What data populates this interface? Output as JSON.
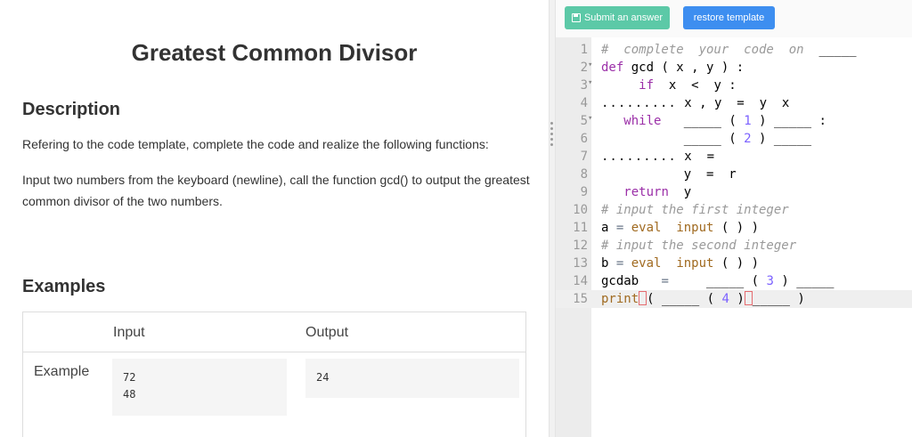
{
  "problem": {
    "title": "Greatest Common Divisor",
    "description_heading": "Description",
    "description_p1": "Refering to the code template, complete the code and realize the following functions:",
    "description_p2": "Input two numbers from the keyboard (newline), call the function gcd() to output the greatest common divisor of the two numbers.",
    "examples_heading": "Examples",
    "examples": {
      "col_input": "Input",
      "col_output": "Output",
      "row_label": "Example",
      "input_line1": "72",
      "input_line2": "48",
      "output": "24"
    }
  },
  "toolbar": {
    "submit_label": "Submit an answer",
    "restore_label": "restore template"
  },
  "editor": {
    "line_numbers": [
      "1",
      "2",
      "3",
      "4",
      "5",
      "6",
      "7",
      "8",
      "9",
      "10",
      "11",
      "12",
      "13",
      "14",
      "15"
    ],
    "l1_comment": "#  complete  your  code  on ",
    "l1_blank": "_____",
    "l2_def": "def",
    "l2_rest": " gcd ( x , y ) :",
    "l3_if": "if",
    "l3_rest": "  x  <  y :",
    "l4_dots": ".........",
    "l4_rest": " x , y  =  y  x",
    "l5_while": "while",
    "l5_blank1": "_____",
    "l5_num": "1",
    "l5_blank2": "_____",
    "l5_colon": ":",
    "l6_blank1": "_____",
    "l6_num": "2",
    "l6_blank2": "_____",
    "l7_dots": ".........",
    "l7_rest": " x  =",
    "l8_rest": "y  =  r",
    "l9_return": "return",
    "l9_rest": "  y",
    "l10_comment": "# input the first integer",
    "l11_a": "a",
    "l11_eq": "=",
    "l11_eval": "eval",
    "l11_input": "input",
    "l11_parens": "( ) )",
    "l12_comment": "# input the second integer",
    "l13_b": "b",
    "l13_eq": "=",
    "l13_eval": "eval",
    "l13_input": "input",
    "l13_parens": "( ) )",
    "l14_gcdab": "gcdab",
    "l14_eq": "=",
    "l14_blank1": "_____",
    "l14_num": "3",
    "l14_blank2": "_____",
    "l15_print": "print",
    "l15_blank1": "_____",
    "l15_num": "4",
    "l15_blank2": "_____",
    "l15_close": ")"
  }
}
